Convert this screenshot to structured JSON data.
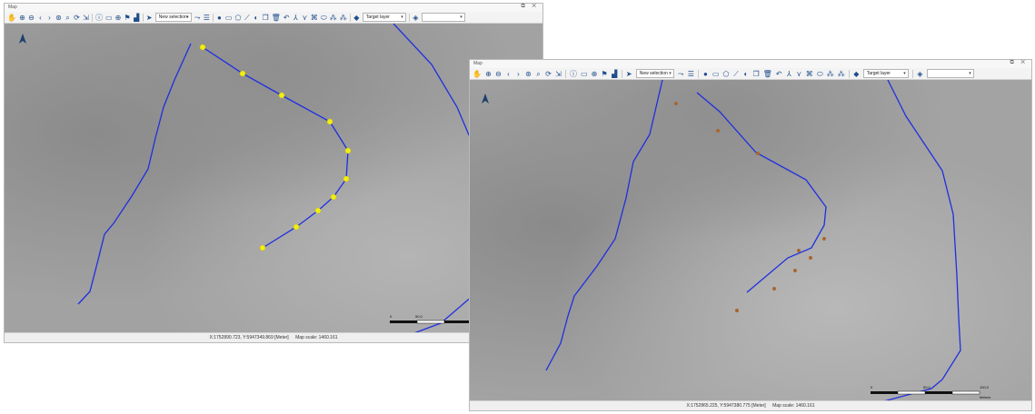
{
  "left_window": {
    "title": "Map",
    "window_controls": [
      "⧉",
      "✕"
    ],
    "toolbar": {
      "selection_mode": "New selection",
      "target_layer": "Target layer"
    },
    "status": {
      "coords": "X:1752890.723, Y:5947349.869 [Meter]",
      "scale": "Map scale: 1460.161"
    },
    "scalebar_labels": [
      "0",
      "50.0"
    ]
  },
  "right_window": {
    "title": "Map",
    "window_controls": [
      "⧉",
      "✕"
    ],
    "toolbar": {
      "selection_mode": "New selection",
      "target_layer": "Target layer"
    },
    "status": {
      "coords": "X:1752865.225, Y:5947380.775 [Meter]",
      "scale": "Map scale: 1460.161"
    },
    "scalebar_labels": [
      "0",
      "50.0",
      "100.0",
      "Meters"
    ]
  },
  "colors": {
    "line": "#1f2fe0",
    "vertex_highlight": "#f2ee11",
    "points": "#a8662e",
    "toolbar_icon": "#1f4e8c"
  },
  "icons": [
    "pan-icon",
    "zoom-in-icon",
    "zoom-out-icon",
    "back-icon",
    "forward-icon",
    "full-extent-icon",
    "select-icon",
    "layer-list-icon",
    "draw-point-icon",
    "draw-rect-icon",
    "draw-polygon-icon",
    "target-layer-icon",
    "layers-icon"
  ]
}
